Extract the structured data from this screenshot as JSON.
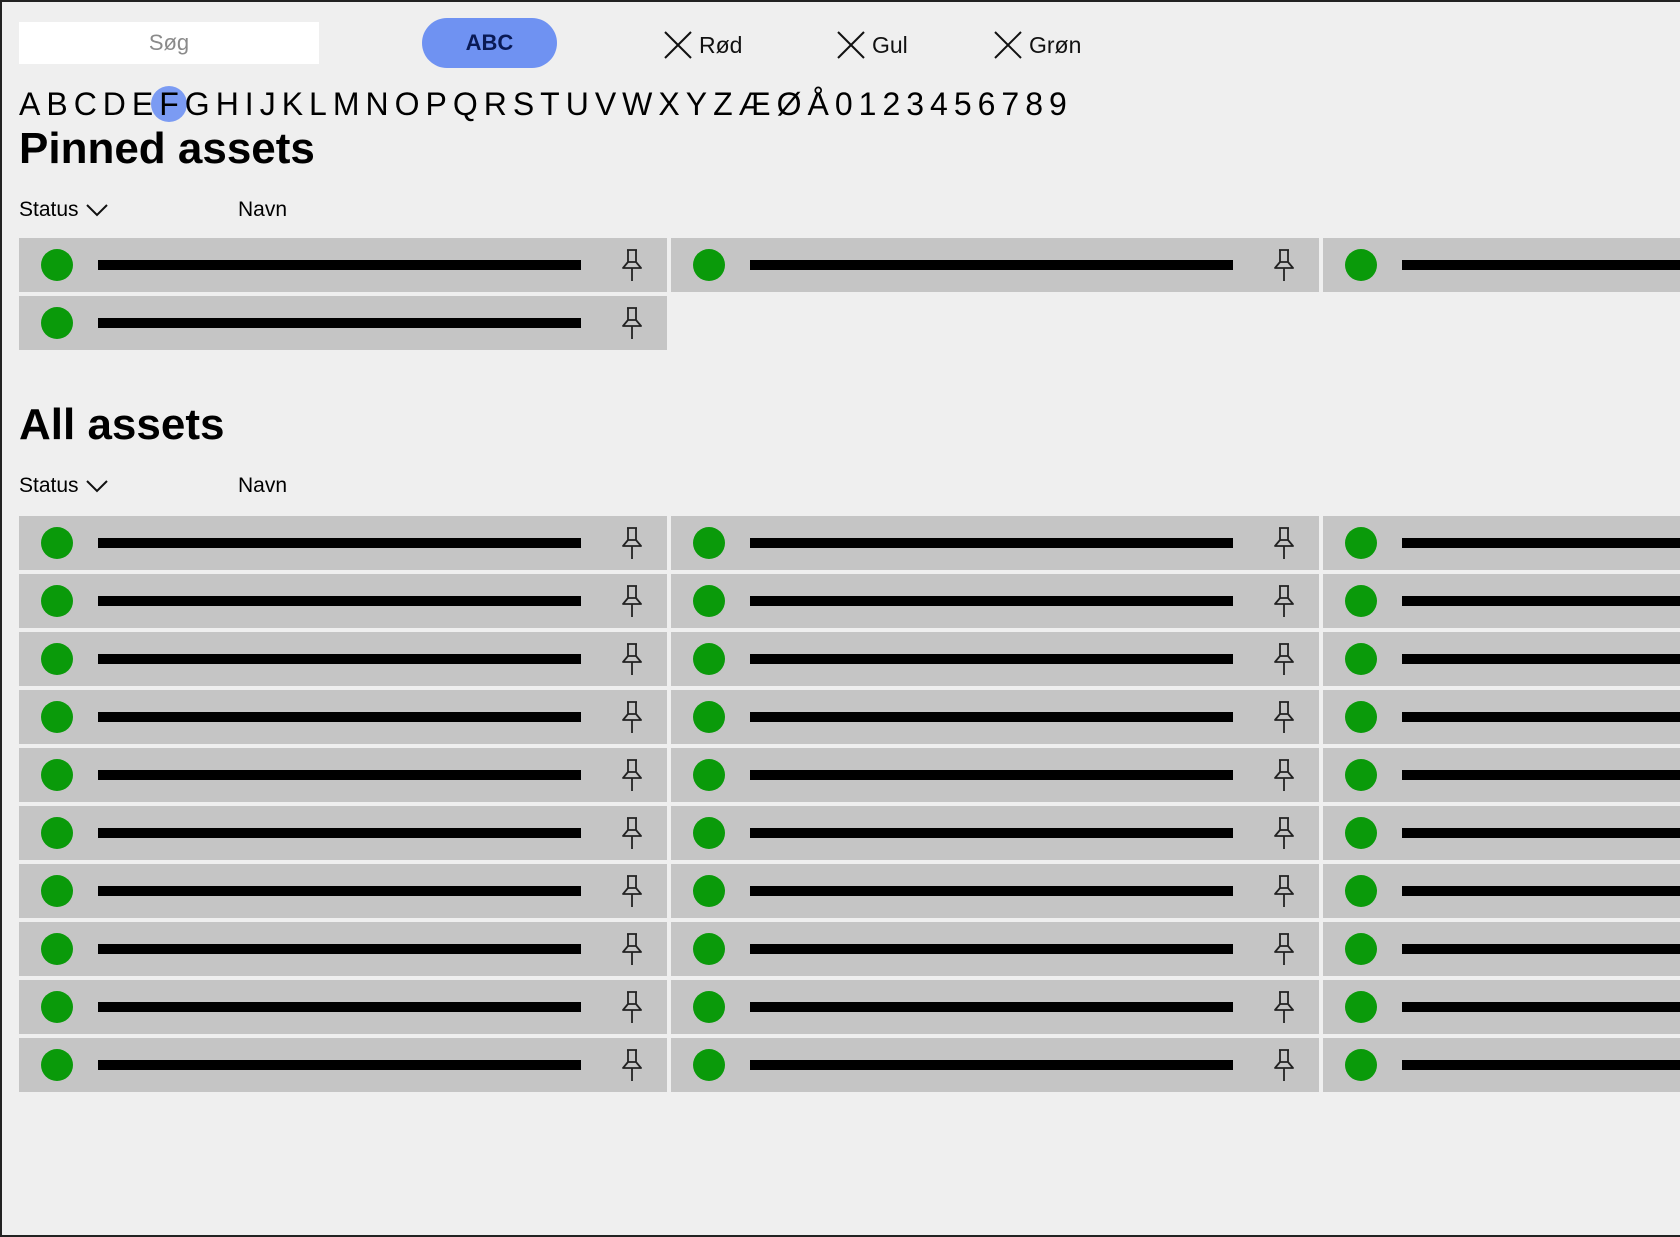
{
  "toolbar": {
    "search_placeholder": "Søg",
    "sort_button": "ABC",
    "filters": [
      {
        "label": "Rød"
      },
      {
        "label": "Gul"
      },
      {
        "label": "Grøn"
      }
    ]
  },
  "alphabet": {
    "letters": [
      "A",
      "B",
      "C",
      "D",
      "E",
      "F",
      "G",
      "H",
      "I",
      "J",
      "K",
      "L",
      "M",
      "N",
      "O",
      "P",
      "Q",
      "R",
      "S",
      "T",
      "U",
      "V",
      "W",
      "X",
      "Y",
      "Z",
      "Æ",
      "Ø",
      "Å",
      "0",
      "1",
      "2",
      "3",
      "4",
      "5",
      "6",
      "7",
      "8",
      "9"
    ],
    "selected": "F"
  },
  "pinned": {
    "title": "Pinned assets",
    "status_header": "Status",
    "name_header": "Navn",
    "columns": 2,
    "rows": 2
  },
  "all": {
    "title": "All assets",
    "status_header": "Status",
    "name_header": "Navn",
    "columns": 3,
    "rows": 10
  },
  "colors": {
    "status_ok": "#0a9a0a",
    "accent": "#6f92f2",
    "row_bg": "#c5c5c5",
    "page_bg": "#efefef"
  },
  "icons": {
    "filter_clear": "close-icon",
    "pin": "pin-icon",
    "sort": "chevron-down-icon"
  }
}
